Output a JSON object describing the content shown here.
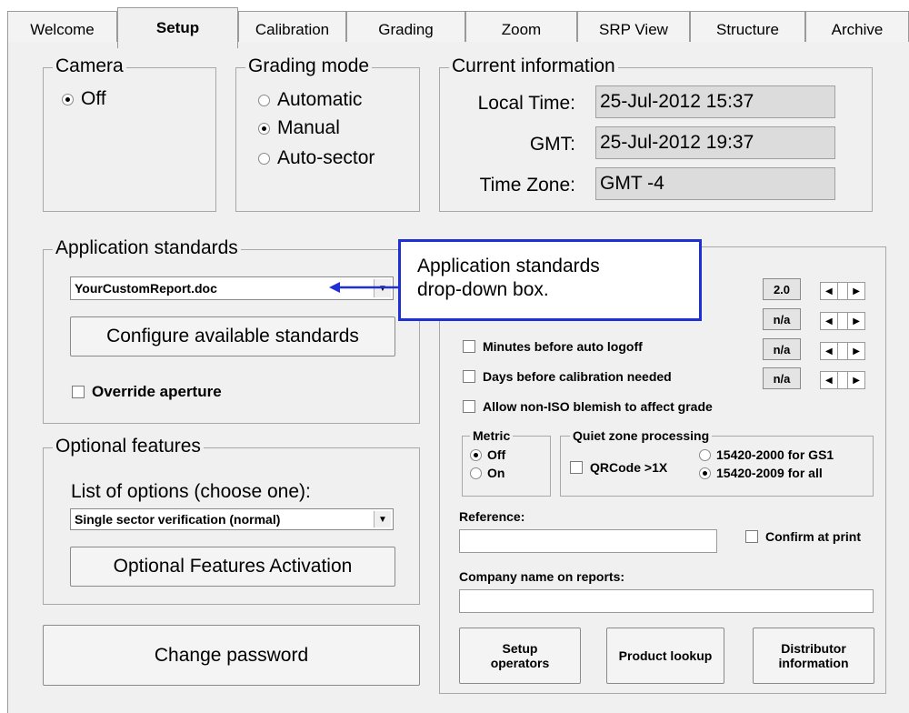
{
  "tabs": [
    "Welcome",
    "Setup",
    "Calibration",
    "Grading",
    "Zoom",
    "SRP View",
    "Structure",
    "Archive"
  ],
  "active_tab": "Setup",
  "camera": {
    "title": "Camera",
    "option_off": "Off"
  },
  "grading_mode": {
    "title": "Grading mode",
    "options": [
      "Automatic",
      "Manual",
      "Auto-sector"
    ],
    "selected": "Manual"
  },
  "current_info": {
    "title": "Current information",
    "local_time_label": "Local Time:",
    "local_time": "25-Jul-2012 15:37",
    "gmt_label": "GMT:",
    "gmt": "25-Jul-2012 19:37",
    "tz_label": "Time Zone:",
    "tz": "GMT -4"
  },
  "app_standards": {
    "title": "Application standards",
    "selected": "YourCustomReport.doc",
    "configure_button": "Configure available standards",
    "override_label": "Override aperture"
  },
  "callout": {
    "line1": "Application standards",
    "line2": "drop-down box."
  },
  "settings": {
    "rows": [
      {
        "label": "",
        "value": "2.0"
      },
      {
        "label": "",
        "value": "n/a"
      },
      {
        "label": "Minutes before auto logoff",
        "value": "n/a"
      },
      {
        "label": "Days before calibration needed",
        "value": "n/a"
      }
    ],
    "allow_blemish": "Allow non-ISO blemish to affect grade"
  },
  "metric": {
    "title": "Metric",
    "options": [
      "Off",
      "On"
    ],
    "selected": "Off"
  },
  "quiet_zone": {
    "title": "Quiet zone processing",
    "qrcode_label": "QRCode >1X",
    "options": [
      "15420-2000 for GS1",
      "15420-2009 for all"
    ],
    "selected": "15420-2009 for all"
  },
  "reference": {
    "label": "Reference:",
    "value": "",
    "confirm_label": "Confirm at print"
  },
  "company": {
    "label": "Company name on reports:",
    "value": ""
  },
  "optional": {
    "title": "Optional features",
    "list_label": "List of options (choose one):",
    "selected": "Single sector verification (normal)",
    "activation_button": "Optional Features Activation"
  },
  "buttons": {
    "change_password": "Change password",
    "setup_operators_1": "Setup",
    "setup_operators_2": "operators",
    "product_lookup": "Product lookup",
    "distributor_1": "Distributor",
    "distributor_2": "information"
  },
  "colors": {
    "callout_border": "#1f2fd6",
    "panel_bg": "#f0f0f0"
  }
}
